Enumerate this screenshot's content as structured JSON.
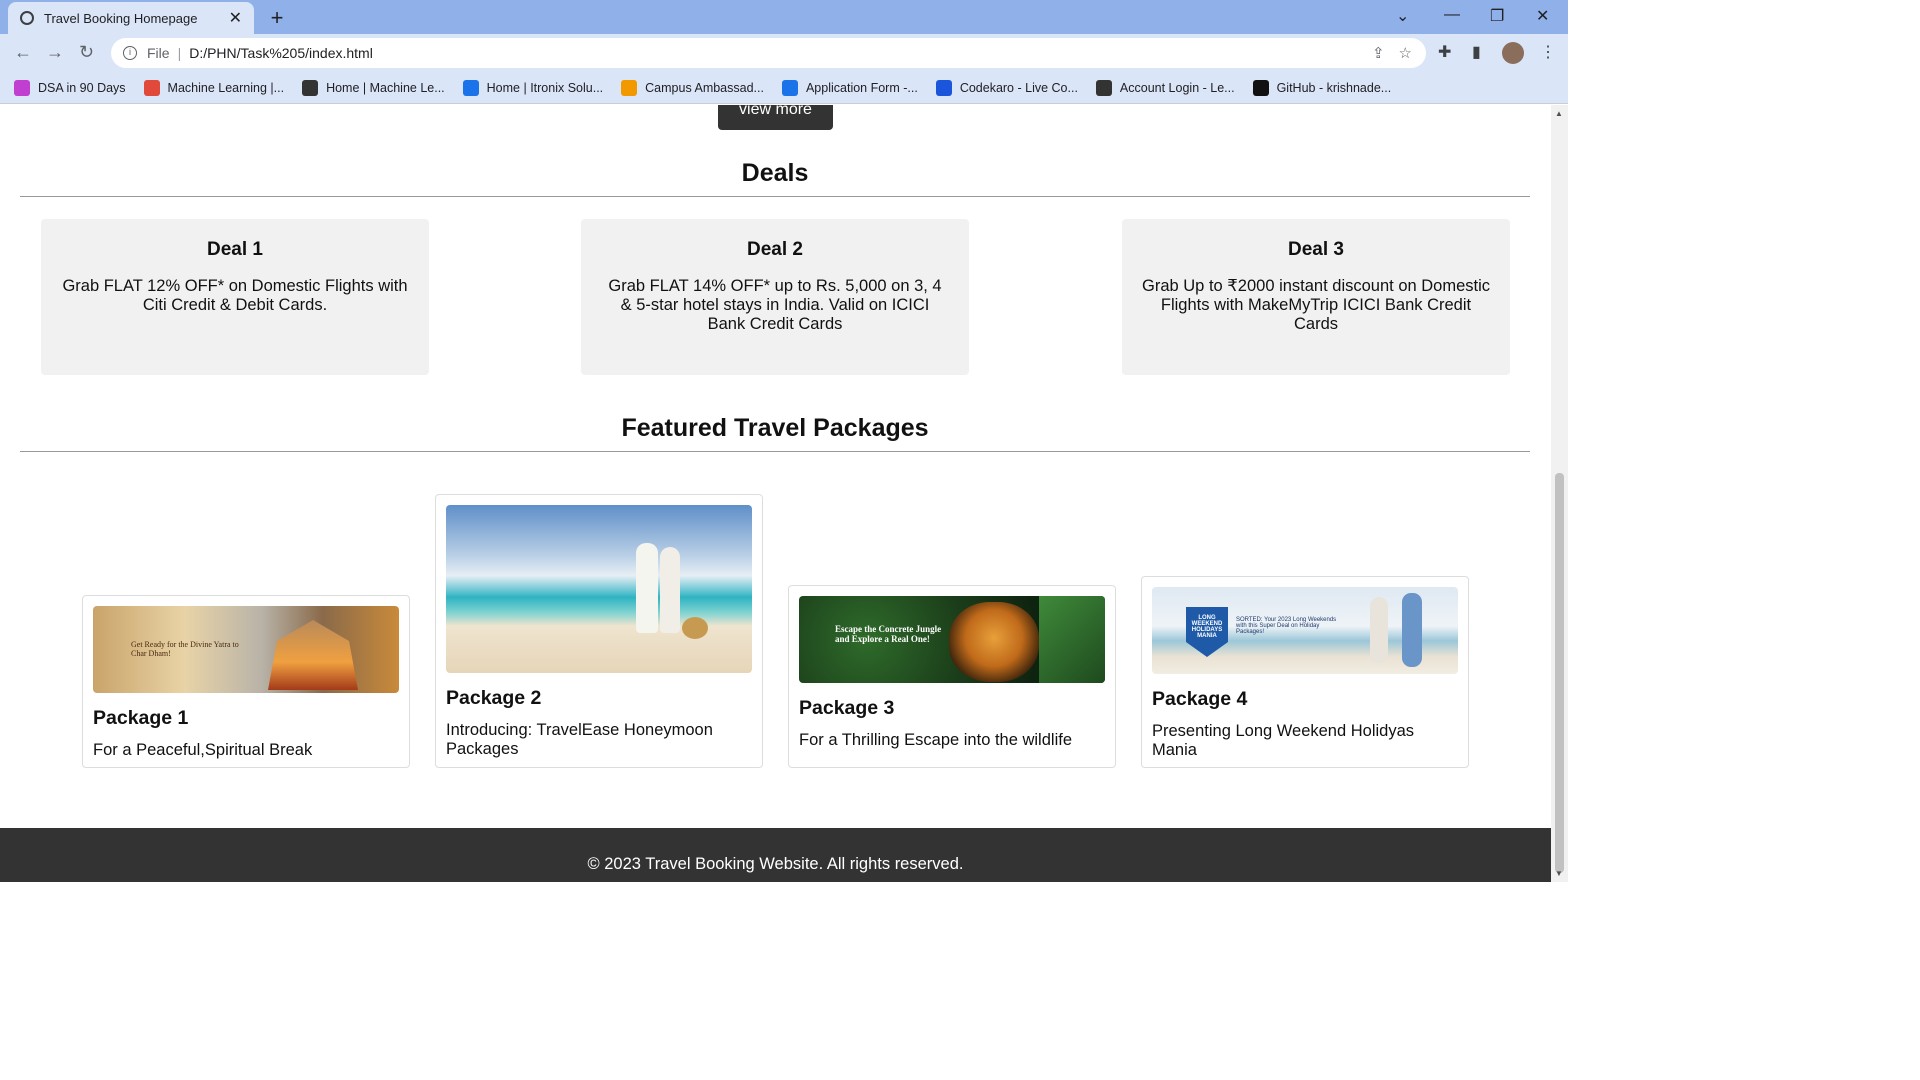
{
  "browser": {
    "tab_title": "Travel Booking Homepage",
    "omnibox_prefix": "File",
    "url": "D:/PHN/Task%205/index.html",
    "bookmarks": [
      {
        "label": "DSA in 90 Days",
        "color": "#c03fd0"
      },
      {
        "label": "Machine Learning  |...",
        "color": "#e14a3b"
      },
      {
        "label": "Home | Machine Le...",
        "color": "#333333"
      },
      {
        "label": "Home | Itronix Solu...",
        "color": "#1a73e8"
      },
      {
        "label": "Campus Ambassad...",
        "color": "#f29900"
      },
      {
        "label": "Application Form -...",
        "color": "#1a73e8"
      },
      {
        "label": "Codekaro - Live Co...",
        "color": "#1a56db"
      },
      {
        "label": "Account Login - Le...",
        "color": "#333333"
      },
      {
        "label": "GitHub - krishnade...",
        "color": "#111111"
      }
    ]
  },
  "page": {
    "view_more": "view more",
    "deals_heading": "Deals",
    "deals": [
      {
        "title": "Deal 1",
        "text": "Grab FLAT 12% OFF* on Domestic Flights with Citi Credit & Debit Cards."
      },
      {
        "title": "Deal 2",
        "text": "Grab FLAT 14% OFF* up to Rs. 5,000 on 3, 4 & 5-star hotel stays in India. Valid on ICICI Bank Credit Cards"
      },
      {
        "title": "Deal 3",
        "text": "Grab Up to ₹2000 instant discount on Domestic Flights with MakeMyTrip ICICI Bank Credit Cards"
      }
    ],
    "packages_heading": "Featured Travel Packages",
    "packages": [
      {
        "title": "Package 1",
        "text": "For a Peaceful,Spiritual Break",
        "banner_text": "Get Ready for the Divine Yatra to Char Dham!"
      },
      {
        "title": "Package 2",
        "text": "Introducing: TravelEase Honeymoon Packages"
      },
      {
        "title": "Package 3",
        "text": "For a Thrilling Escape into the wildlife",
        "banner_text": "Escape the Concrete Jungle and Explore a Real One!"
      },
      {
        "title": "Package 4",
        "text": "Presenting Long Weekend Holidyas Mania",
        "badge_text": "LONG WEEKEND HOLIDAYS MANIA",
        "banner_text": "SORTED: Your 2023 Long Weekends with this Super Deal on Holiday Packages!"
      }
    ],
    "footer": "© 2023 Travel Booking Website. All rights reserved."
  }
}
